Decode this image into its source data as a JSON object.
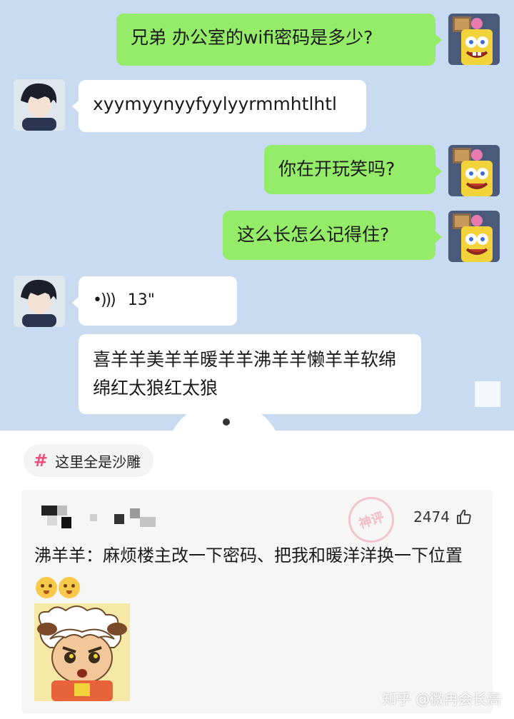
{
  "chat": {
    "messages": [
      {
        "sender": "me",
        "text": "兄弟 办公室的wifi密码是多少?"
      },
      {
        "sender": "friend",
        "text": "xyymyynyyfyylyyrmmhtlhtl"
      },
      {
        "sender": "me",
        "text": "你在开玩笑吗?"
      },
      {
        "sender": "me",
        "text": "这么长怎么记得住?"
      },
      {
        "sender": "friend",
        "type": "voice",
        "duration": "13\""
      },
      {
        "sender": "friend",
        "text": "喜羊羊美羊羊暖羊羊沸羊羊懒羊羊软绵绵红太狼红太狼"
      }
    ],
    "voice_icon": "•)))"
  },
  "post": {
    "topic_label": "这里全是沙雕",
    "comment": {
      "likes": "2474",
      "text": "沸羊羊：麻烦楼主改一下密码、把我和暖洋洋换一下位置",
      "emoji_icon": "pleading-face-emoji"
    },
    "stamp_text": "神评"
  },
  "watermark": "知乎 @微冉会长高",
  "colors": {
    "chat_bg": "#c9dbf0",
    "my_bubble": "#95ec69",
    "friend_bubble": "#ffffff",
    "topic_hash": "#f04e7a"
  }
}
